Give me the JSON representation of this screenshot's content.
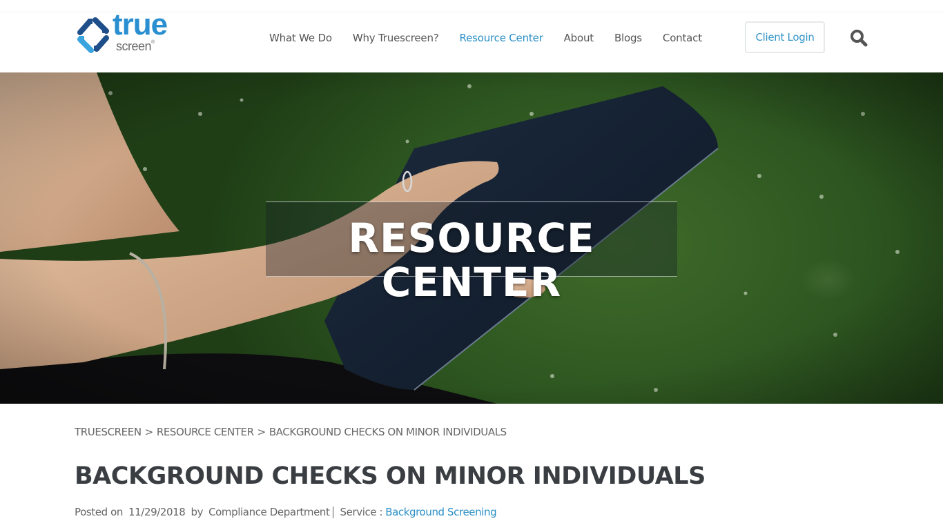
{
  "brand": {
    "name": "true",
    "subname": "screen",
    "registered_mark": "®",
    "colors": {
      "primary_blue": "#2a8fd0",
      "dark_blue": "#1f4f8a",
      "accent_link": "#2a8fc6",
      "text_gray": "#666666",
      "title_dark": "#3a3e42"
    }
  },
  "nav": {
    "items": [
      {
        "label": "What We Do",
        "active": false
      },
      {
        "label": "Why Truescreen?",
        "active": false
      },
      {
        "label": "Resource Center",
        "active": true
      },
      {
        "label": "About",
        "active": false
      },
      {
        "label": "Blogs",
        "active": false
      },
      {
        "label": "Contact",
        "active": false
      }
    ],
    "client_login_label": "Client Login",
    "search_icon": "search-icon"
  },
  "hero": {
    "title": "RESOURCE CENTER",
    "image_description": "hand holding a tablet over grass"
  },
  "breadcrumb": {
    "items": [
      "TRUESCREEN",
      "RESOURCE CENTER",
      "BACKGROUND CHECKS ON MINOR INDIVIDUALS"
    ],
    "separator": ">"
  },
  "article": {
    "title": "BACKGROUND CHECKS ON MINOR INDIVIDUALS",
    "posted_on_label": "Posted on",
    "date": "11/29/2018",
    "by_label": "by",
    "author": "Compliance Department",
    "service_label": "Service :",
    "service_value": "Background Screening"
  }
}
